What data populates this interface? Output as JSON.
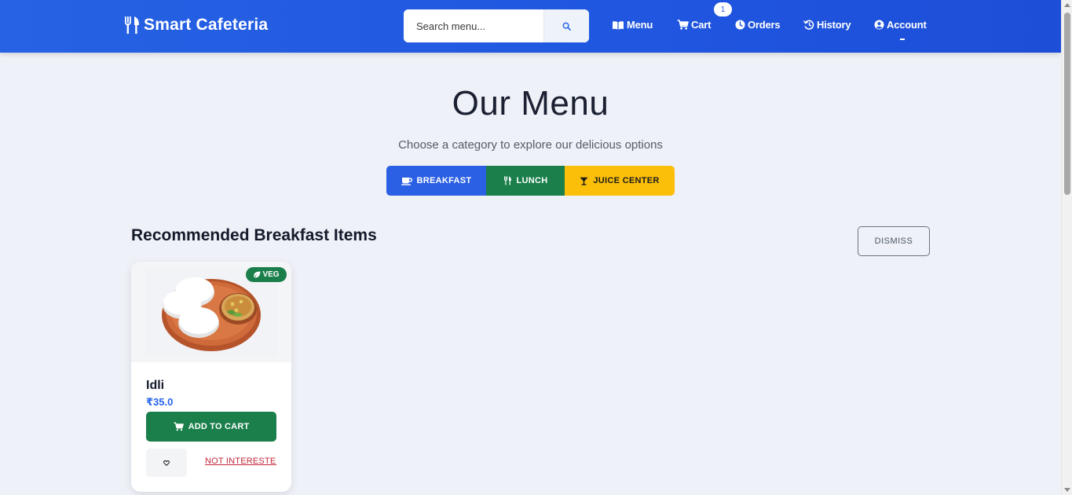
{
  "navbar": {
    "brand": "Smart Cafeteria",
    "search_placeholder": "Search menu...",
    "items": [
      {
        "label": "Menu",
        "icon": "book-open-icon"
      },
      {
        "label": "Cart",
        "icon": "shopping-cart-icon",
        "badge": "1"
      },
      {
        "label": "Orders",
        "icon": "clock-icon"
      },
      {
        "label": "History",
        "icon": "history-icon"
      },
      {
        "label": "Account",
        "icon": "user-circle-icon"
      }
    ]
  },
  "hero": {
    "title": "Our Menu",
    "subtitle": "Choose a category to explore our delicious options"
  },
  "categories": [
    {
      "label": "BREAKFAST",
      "icon": "coffee-icon",
      "color": "#2b5fe4",
      "active": true
    },
    {
      "label": "LUNCH",
      "icon": "utensils-icon",
      "color": "#1a7f4b",
      "active": false
    },
    {
      "label": "JUICE CENTER",
      "icon": "cocktail-icon",
      "color": "#fbbf0a",
      "active": false
    }
  ],
  "recommended": {
    "title": "Recommended Breakfast Items",
    "dismiss_label": "DISMISS",
    "items": [
      {
        "name": "Idli",
        "price": "₹35.0",
        "badge": "VEG",
        "add_label": "ADD TO CART",
        "not_interested_label": "NOT INTERESTED"
      }
    ]
  },
  "colors": {
    "primary": "#2662e3",
    "success": "#1a7f4b",
    "warning": "#fbbf0a",
    "danger": "#c0283c"
  }
}
